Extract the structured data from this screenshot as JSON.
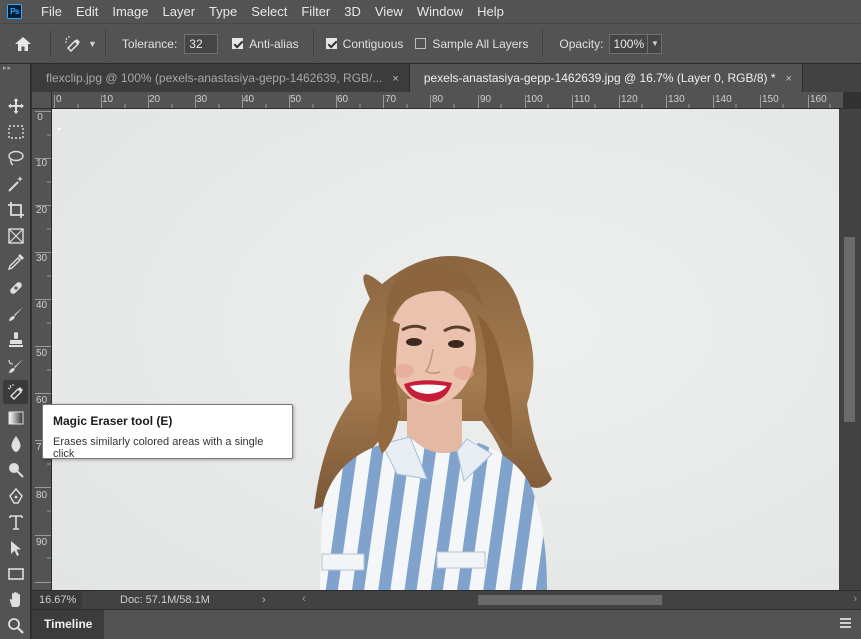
{
  "app": {
    "logo": "Ps"
  },
  "menu": [
    "File",
    "Edit",
    "Image",
    "Layer",
    "Type",
    "Select",
    "Filter",
    "3D",
    "View",
    "Window",
    "Help"
  ],
  "options": {
    "tolerance_label": "Tolerance:",
    "tolerance_value": "32",
    "antialias_label": "Anti-alias",
    "antialias_checked": true,
    "contiguous_label": "Contiguous",
    "contiguous_checked": true,
    "sample_all_label": "Sample All Layers",
    "sample_all_checked": false,
    "opacity_label": "Opacity:",
    "opacity_value": "100%"
  },
  "tabs": [
    {
      "label": "flexclip.jpg @ 100% (pexels-anastasiya-gepp-1462639, RGB/...",
      "close": "×",
      "active": false
    },
    {
      "label": "pexels-anastasiya-gepp-1462639.jpg @ 16.7% (Layer 0, RGB/8) *",
      "close": "×",
      "active": true
    }
  ],
  "ruler_top": [
    "0",
    "10",
    "20",
    "30",
    "40",
    "50",
    "60",
    "70",
    "80",
    "90",
    "100",
    "110",
    "120",
    "130",
    "140",
    "150",
    "160"
  ],
  "ruler_left": [
    "0",
    "10",
    "20",
    "30",
    "40",
    "50",
    "60",
    "70",
    "80",
    "90"
  ],
  "tools": [
    "move-icon",
    "marquee-icon",
    "lasso-icon",
    "magic-wand-icon",
    "crop-icon",
    "frame-icon",
    "eyedropper-icon",
    "healing-brush-icon",
    "brush-icon",
    "clone-stamp-icon",
    "history-brush-icon",
    "magic-eraser-icon",
    "gradient-icon",
    "blur-icon",
    "dodge-icon",
    "pen-icon",
    "type-icon",
    "path-selection-icon",
    "rectangle-icon",
    "hand-icon",
    "zoom-icon"
  ],
  "tooltip": {
    "title": "Magic Eraser tool (E)",
    "description": "Erases similarly colored areas with a single click"
  },
  "status": {
    "zoom": "16.67%",
    "doc": "Doc: 57.1M/58.1M",
    "arrow": "›"
  },
  "timeline": {
    "label": "Timeline"
  },
  "colors": {
    "chrome": "#535353",
    "dark": "#323232",
    "canvas_bg": "#e9ebea",
    "accent": "#31a8ff"
  }
}
